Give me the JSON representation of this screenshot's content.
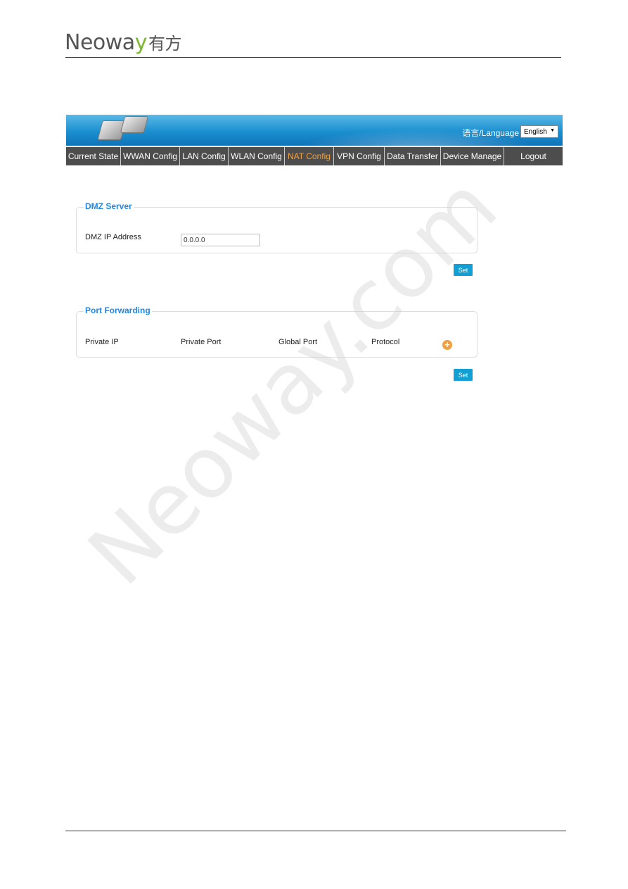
{
  "doc_header": {
    "logo_text": "Neoway",
    "logo_cn": "有方"
  },
  "watermark": "Neoway.com",
  "banner": {
    "language_label": "语言/Language",
    "language_value": "English"
  },
  "nav": {
    "tabs": [
      {
        "label": "Current State"
      },
      {
        "label": "WWAN Config"
      },
      {
        "label": "LAN Config"
      },
      {
        "label": "WLAN Config"
      },
      {
        "label": "NAT Config",
        "active": true
      },
      {
        "label": "VPN Config"
      },
      {
        "label": "Data Transfer"
      },
      {
        "label": "Device Manage"
      },
      {
        "label": "Logout"
      }
    ]
  },
  "dmz": {
    "title": "DMZ Server",
    "ip_label": "DMZ IP Address",
    "ip_value": "0.0.0.0",
    "set_label": "Set"
  },
  "port_forwarding": {
    "title": "Port Forwarding",
    "columns": [
      "Private IP",
      "Private Port",
      "Global Port",
      "Protocol"
    ],
    "add_icon": "plus-circle-icon",
    "set_label": "Set"
  },
  "colors": {
    "accent": "#1e88e5",
    "active_tab": "#f0a040",
    "button": "#12a0d4",
    "nav_bg": "#4d4d4d"
  }
}
